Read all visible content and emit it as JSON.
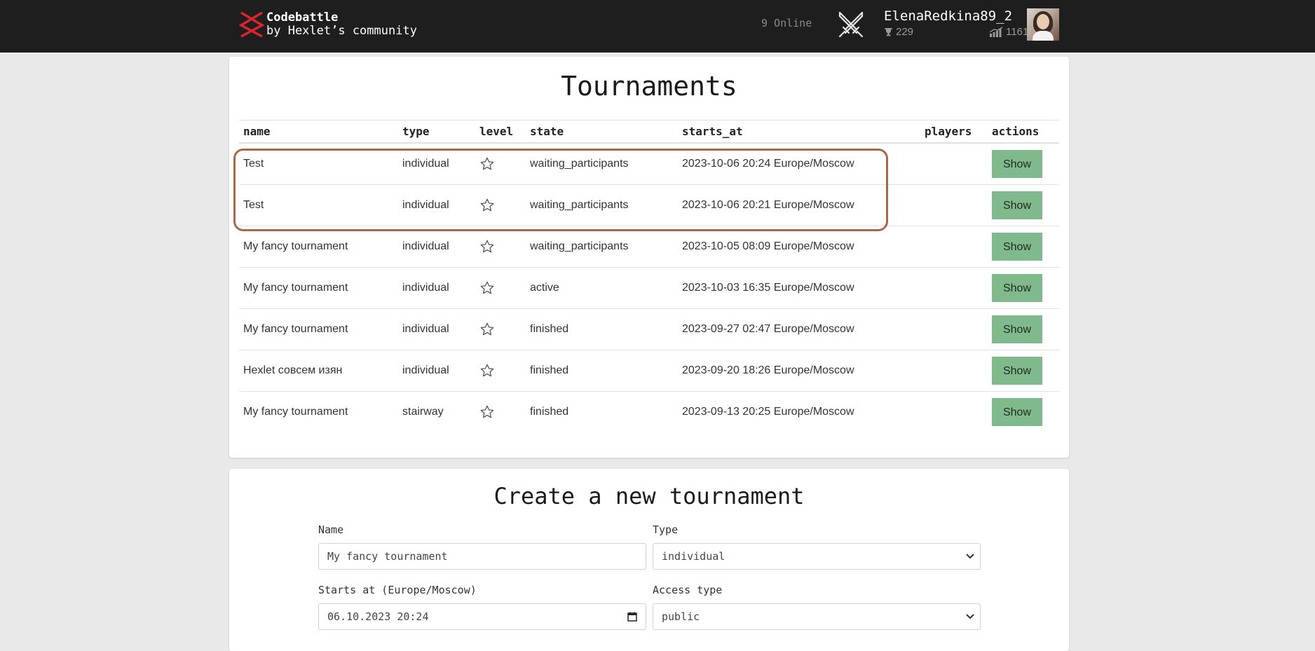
{
  "brand": {
    "title": "Codebattle",
    "subtitle": "by Hexlet’s community"
  },
  "header": {
    "online": "9 Online",
    "user_name": "ElenaRedkina89_2",
    "trophies": "229",
    "rating": "1161"
  },
  "tournaments": {
    "title": "Tournaments",
    "columns": [
      "name",
      "type",
      "level",
      "state",
      "starts_at",
      "players",
      "actions"
    ],
    "rows": [
      {
        "name": "Test",
        "type": "individual",
        "state": "waiting_participants",
        "starts_at": "2023-10-06 20:24 Europe/Moscow",
        "players": "",
        "action": "Show"
      },
      {
        "name": "Test",
        "type": "individual",
        "state": "waiting_participants",
        "starts_at": "2023-10-06 20:21 Europe/Moscow",
        "players": "",
        "action": "Show"
      },
      {
        "name": "My fancy tournament",
        "type": "individual",
        "state": "waiting_participants",
        "starts_at": "2023-10-05 08:09 Europe/Moscow",
        "players": "",
        "action": "Show"
      },
      {
        "name": "My fancy tournament",
        "type": "individual",
        "state": "active",
        "starts_at": "2023-10-03 16:35 Europe/Moscow",
        "players": "",
        "action": "Show"
      },
      {
        "name": "My fancy tournament",
        "type": "individual",
        "state": "finished",
        "starts_at": "2023-09-27 02:47 Europe/Moscow",
        "players": "",
        "action": "Show"
      },
      {
        "name": "Hexlet совсем изян",
        "type": "individual",
        "state": "finished",
        "starts_at": "2023-09-20 18:26 Europe/Moscow",
        "players": "",
        "action": "Show"
      },
      {
        "name": "My fancy tournament",
        "type": "stairway",
        "state": "finished",
        "starts_at": "2023-09-13 20:25 Europe/Moscow",
        "players": "",
        "action": "Show"
      }
    ]
  },
  "create": {
    "title": "Create a new tournament",
    "name_label": "Name",
    "name_value": "My fancy tournament",
    "type_label": "Type",
    "type_value": "individual",
    "starts_label": "Starts at (Europe/Moscow)",
    "starts_value": "06.10.2023 20:24",
    "access_label": "Access type",
    "access_value": "public"
  },
  "colors": {
    "navbar": "#1e1e1e",
    "show_button": "#80b98c",
    "highlight": "#a8694a",
    "logo_red": "#d9262b"
  }
}
